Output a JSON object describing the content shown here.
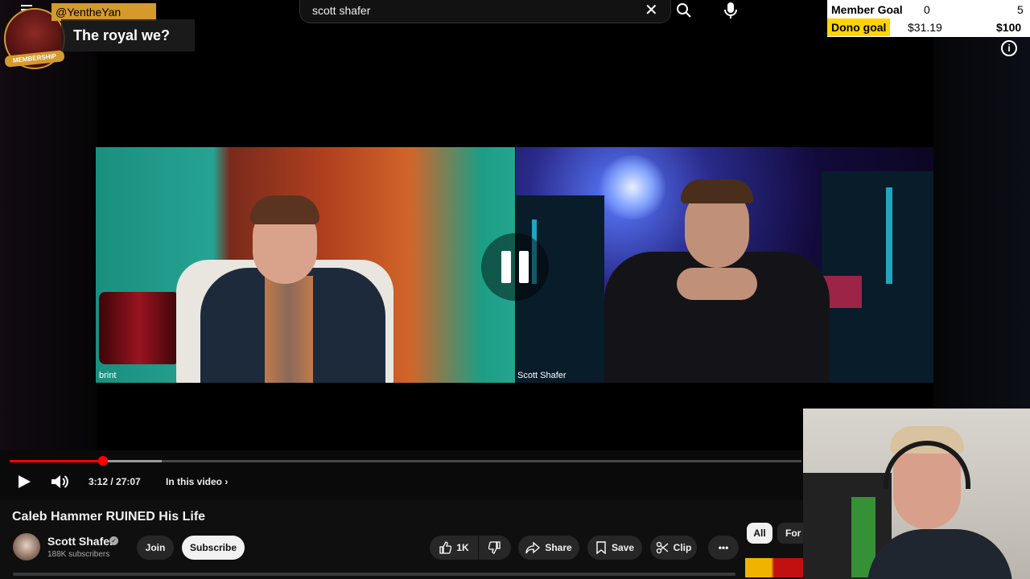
{
  "search": {
    "query": "scott shafer"
  },
  "chat": {
    "username": "@YentheYan",
    "message": "The royal we?",
    "badge": "MEMBERSHIP"
  },
  "goals": {
    "member_label": "Member Goal",
    "member_current": "0",
    "member_target": "5",
    "dono_label": "Dono goal",
    "dono_current": "$31.19",
    "dono_target": "$100"
  },
  "video": {
    "left_cam_label": "brint",
    "right_cam_label": "Scott Shafer",
    "time": "3:12 / 27:07",
    "in_this_video": "In this video",
    "progress_fraction": 0.118
  },
  "meta": {
    "title": "Caleb Hammer RUINED His Life",
    "channel": "Scott Shafer",
    "subscribers": "188K subscribers",
    "join_label": "Join",
    "subscribe_label": "Subscribe",
    "like_count": "1K",
    "share_label": "Share",
    "save_label": "Save",
    "clip_label": "Clip"
  },
  "chips": {
    "all": "All",
    "for": "For"
  },
  "colors": {
    "accent": "#ff0000",
    "membership": "#d49a2e",
    "dono_highlight": "#ffd400"
  }
}
